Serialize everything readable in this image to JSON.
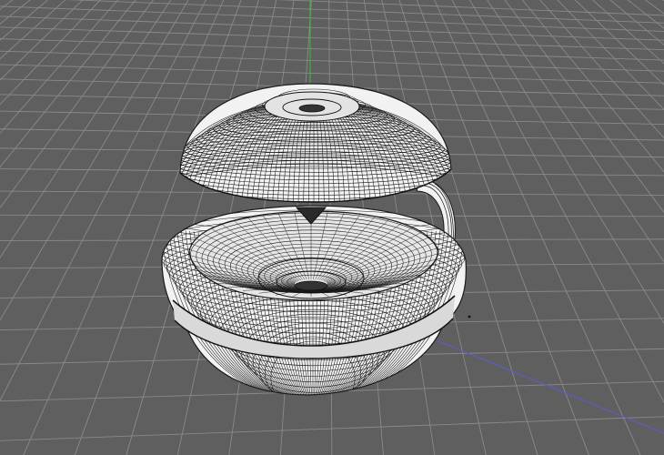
{
  "viewport": {
    "background": "#5f5f5f",
    "grid_line_color": "#8a8a8a",
    "axis_colors": {
      "y": "#38c23a",
      "x": "#5b5bd6"
    }
  },
  "model": {
    "render_mode": "wireframe",
    "surface_color": "#f2f2f2",
    "wire_color": "#1a1a1a",
    "parts": [
      "lid-dome",
      "lid-pointer",
      "bowl-shell",
      "inner-bowl",
      "bottom-hemisphere",
      "hinge-arm"
    ]
  }
}
